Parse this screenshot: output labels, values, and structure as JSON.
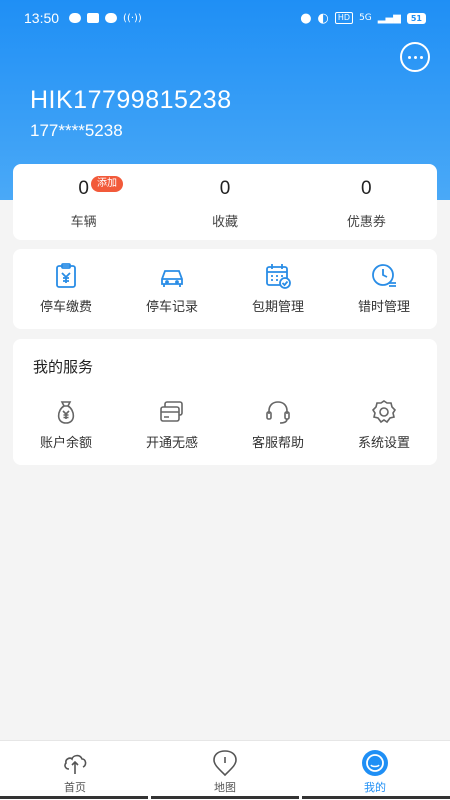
{
  "status_bar": {
    "time": "13:50",
    "network": "5G",
    "hd": "HD",
    "battery": "51"
  },
  "profile": {
    "username": "HIK17799815238",
    "phone": "177****5238"
  },
  "stats": [
    {
      "value": "0",
      "label": "车辆",
      "badge": "添加"
    },
    {
      "value": "0",
      "label": "收藏"
    },
    {
      "value": "0",
      "label": "优惠券"
    }
  ],
  "tools": [
    {
      "label": "停车缴费",
      "icon": "parking-pay-icon"
    },
    {
      "label": "停车记录",
      "icon": "car-icon"
    },
    {
      "label": "包期管理",
      "icon": "calendar-check-icon"
    },
    {
      "label": "错时管理",
      "icon": "clock-icon"
    }
  ],
  "services": {
    "title": "我的服务",
    "items": [
      {
        "label": "账户余额",
        "icon": "money-bag-icon"
      },
      {
        "label": "开通无感",
        "icon": "card-icon"
      },
      {
        "label": "客服帮助",
        "icon": "headset-icon"
      },
      {
        "label": "系统设置",
        "icon": "gear-icon"
      }
    ]
  },
  "tabs": [
    {
      "label": "首页",
      "icon": "home-cloud-icon"
    },
    {
      "label": "地图",
      "icon": "map-pin-icon"
    },
    {
      "label": "我的",
      "icon": "profile-icon",
      "active": true
    }
  ],
  "colors": {
    "primary": "#1f8ff5",
    "badge": "#f25a3a",
    "background": "#f4f4f4"
  }
}
